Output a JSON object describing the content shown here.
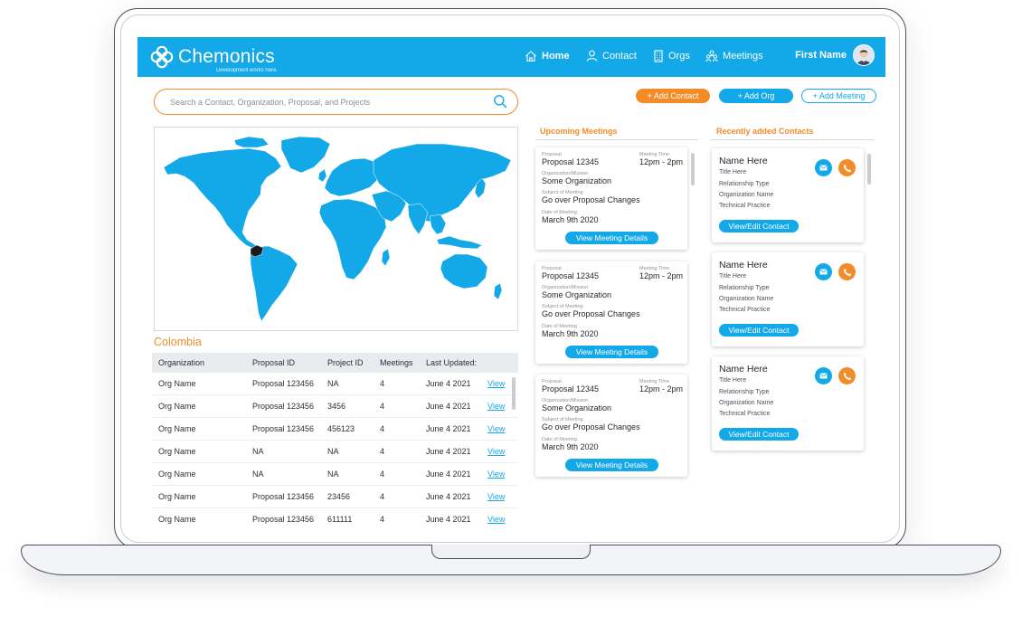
{
  "brand": {
    "name": "Chemonics",
    "tagline": "Development works here."
  },
  "nav": {
    "items": [
      {
        "label": "Home",
        "icon": "home-icon",
        "active": true
      },
      {
        "label": "Contact",
        "icon": "user-icon",
        "active": false
      },
      {
        "label": "Orgs",
        "icon": "building-icon",
        "active": false
      },
      {
        "label": "Meetings",
        "icon": "people-icon",
        "active": false
      }
    ],
    "user_name": "First Name"
  },
  "search": {
    "placeholder": "Search a Contact, Organization, Proposal, and Projects"
  },
  "actions": {
    "add_contact": "+ Add Contact",
    "add_org": "+ Add Org",
    "add_meeting": "+ Add Meeting"
  },
  "country": "Colombia",
  "table": {
    "headers": [
      "Organization",
      "Proposal ID",
      "Project ID",
      "Meetings",
      "Last Updated:"
    ],
    "link_label": "View",
    "rows": [
      [
        "Org Name",
        "Proposal 123456",
        "NA",
        "4",
        "June 4 2021"
      ],
      [
        "Org Name",
        "Proposal 123456",
        "3456",
        "4",
        "June 4 2021"
      ],
      [
        "Org Name",
        "Proposal 123456",
        "456123",
        "4",
        "June 4 2021"
      ],
      [
        "Org Name",
        "NA",
        "NA",
        "4",
        "June 4 2021"
      ],
      [
        "Org Name",
        "NA",
        "NA",
        "4",
        "June 4 2021"
      ],
      [
        "Org Name",
        "Proposal 123456",
        "23456",
        "4",
        "June 4 2021"
      ],
      [
        "Org Name",
        "Proposal 123456",
        "611111",
        "4",
        "June 4 2021"
      ]
    ]
  },
  "meetings": {
    "title": "Upcoming Meetings",
    "labels": {
      "proposal": "Proposal",
      "time": "Meeting Time",
      "org": "Organization/Mission",
      "subject": "Subject of Meeting",
      "date": "Date of Meeting"
    },
    "button": "View Meeting Details",
    "items": [
      {
        "proposal": "Proposal 12345",
        "time": "12pm - 2pm",
        "org": "Some Organization",
        "subject": "Go over Proposal Changes",
        "date": "March 9th 2020"
      },
      {
        "proposal": "Proposal 12345",
        "time": "12pm - 2pm",
        "org": "Some Organization",
        "subject": "Go over Proposal Changes",
        "date": "March 9th 2020"
      },
      {
        "proposal": "Proposal 12345",
        "time": "12pm - 2pm",
        "org": "Some Organization",
        "subject": "Go over Proposal Changes",
        "date": "March 9th 2020"
      }
    ]
  },
  "contacts": {
    "title": "Recently added Contacts",
    "button": "View/Edit Contact",
    "items": [
      {
        "name": "Name Here",
        "title": "Title Here",
        "relationship": "Relationship Type",
        "org": "Organization Name",
        "practice": "Technical Practice"
      },
      {
        "name": "Name Here",
        "title": "Title Here",
        "relationship": "Relationship Type",
        "org": "Organization Name",
        "practice": "Technical Practice"
      },
      {
        "name": "Name Here",
        "title": "Title Here",
        "relationship": "Relationship Type",
        "org": "Organization Name",
        "practice": "Technical Practice"
      }
    ]
  },
  "colors": {
    "primary": "#13a8e8",
    "accent": "#f28c28",
    "map_land": "#13a8e8",
    "selected_country": "#1a1a1a"
  }
}
